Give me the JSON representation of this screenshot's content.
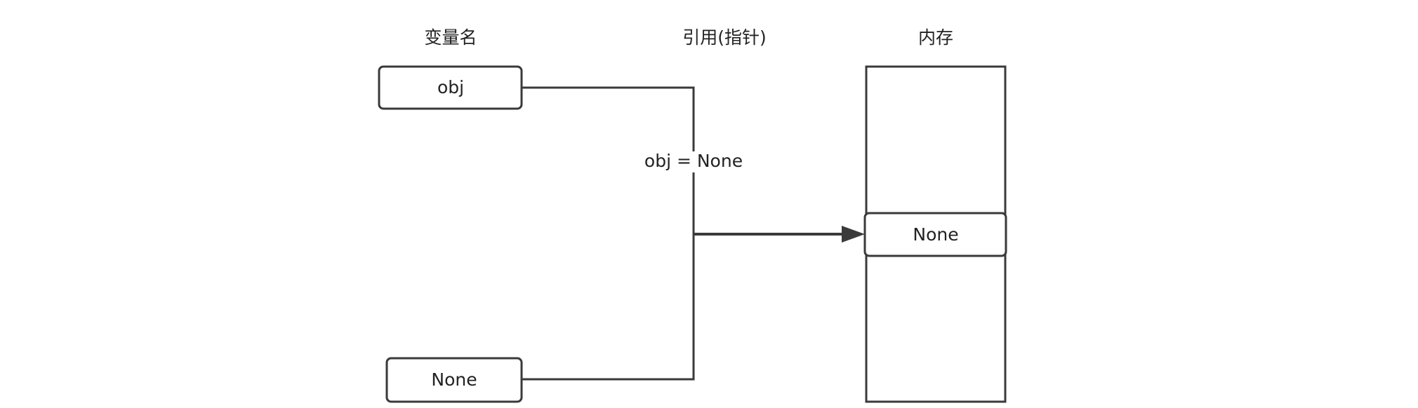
{
  "headers": {
    "variable_name": "变量名",
    "reference": "引用(指针)",
    "memory": "内存"
  },
  "nodes": {
    "obj_box": "obj",
    "none_var_box": "None",
    "memory_none_cell": "None"
  },
  "edge_labels": {
    "assignment": "obj = None"
  },
  "colors": {
    "stroke": "#3a3a3a",
    "text": "#222222",
    "background": "#ffffff"
  }
}
